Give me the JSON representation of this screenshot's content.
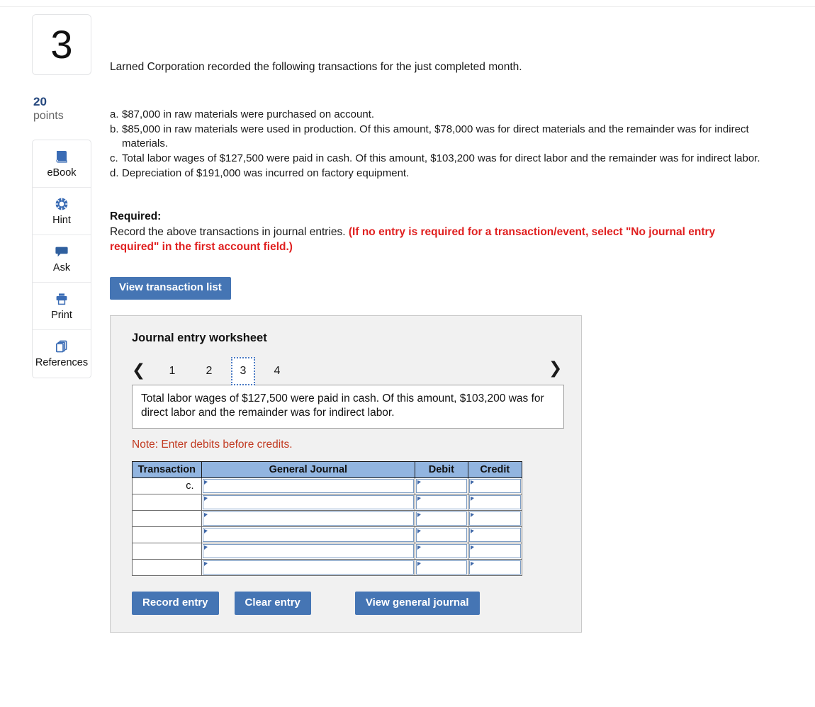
{
  "question": {
    "number": "3",
    "points_value": "20",
    "points_label": "points",
    "intro": "Larned Corporation recorded the following transactions for the just completed month.",
    "transactions": [
      {
        "key": "a.",
        "text": "$87,000 in raw materials were purchased on account."
      },
      {
        "key": "b.",
        "text": "$85,000 in raw materials were used in production. Of this amount, $78,000 was for direct materials and the remainder was for indirect materials."
      },
      {
        "key": "c.",
        "text": "Total labor wages of $127,500 were paid in cash. Of this amount, $103,200 was for direct labor and the remainder was for indirect labor."
      },
      {
        "key": "d.",
        "text": "Depreciation of $191,000 was incurred on factory equipment."
      }
    ]
  },
  "required": {
    "heading": "Required:",
    "text": "Record the above transactions in journal entries. ",
    "red_text": "(If no entry is required for a transaction/event, select \"No journal entry required\" in the first account field.)"
  },
  "view_transaction_list_label": "View transaction list",
  "sidebar": {
    "items": [
      {
        "label": "eBook",
        "icon": "ebook-icon"
      },
      {
        "label": "Hint",
        "icon": "hint-icon"
      },
      {
        "label": "Ask",
        "icon": "ask-icon"
      },
      {
        "label": "Print",
        "icon": "print-icon"
      },
      {
        "label": "References",
        "icon": "references-icon"
      }
    ]
  },
  "worksheet": {
    "title": "Journal entry worksheet",
    "prev_icon": "chevron-left-icon",
    "next_icon": "chevron-right-icon",
    "tabs": [
      {
        "label": "1",
        "active": false
      },
      {
        "label": "2",
        "active": false
      },
      {
        "label": "3",
        "active": true
      },
      {
        "label": "4",
        "active": false
      }
    ],
    "description": "Total labor wages of $127,500 were paid in cash. Of this amount, $103,200 was for direct labor and the remainder was for indirect labor.",
    "note": "Note: Enter debits before credits.",
    "table": {
      "headers": [
        "Transaction",
        "General Journal",
        "Debit",
        "Credit"
      ],
      "rows": [
        {
          "transaction": "c.",
          "general_journal": "",
          "debit": "",
          "credit": ""
        },
        {
          "transaction": "",
          "general_journal": "",
          "debit": "",
          "credit": ""
        },
        {
          "transaction": "",
          "general_journal": "",
          "debit": "",
          "credit": ""
        },
        {
          "transaction": "",
          "general_journal": "",
          "debit": "",
          "credit": ""
        },
        {
          "transaction": "",
          "general_journal": "",
          "debit": "",
          "credit": ""
        },
        {
          "transaction": "",
          "general_journal": "",
          "debit": "",
          "credit": ""
        }
      ]
    },
    "buttons": {
      "record": "Record entry",
      "clear": "Clear entry",
      "view_journal": "View general journal"
    }
  },
  "colors": {
    "button_blue": "#4575b4",
    "table_header_blue": "#92b5e0",
    "red": "#e02020",
    "note_red": "#c23b22",
    "points_navy": "#23467d"
  }
}
